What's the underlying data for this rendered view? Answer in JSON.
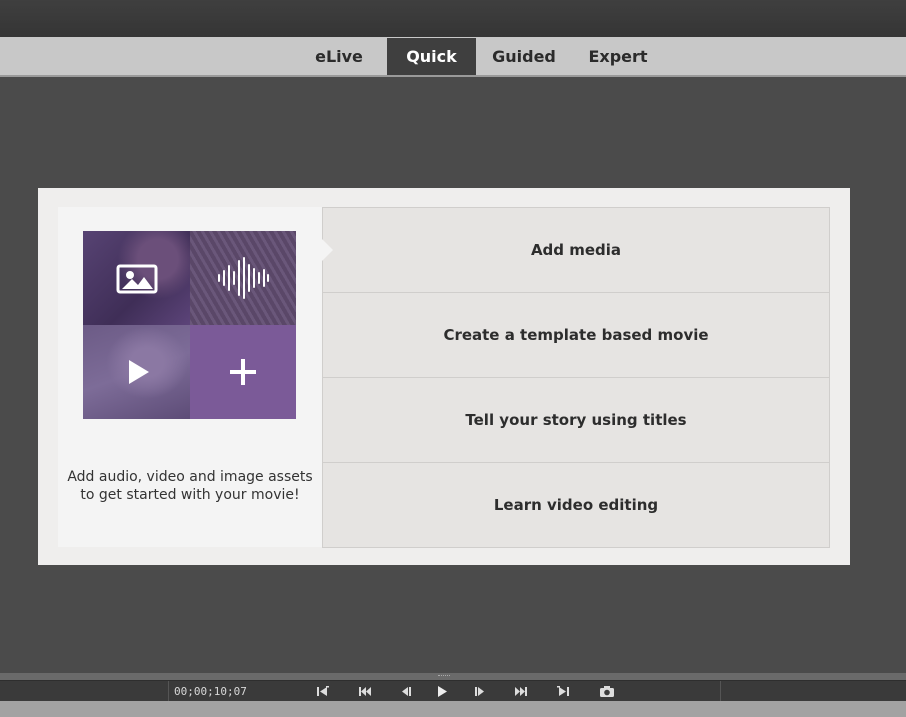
{
  "mode_tabs": [
    {
      "label": "eLive",
      "active": false
    },
    {
      "label": "Quick",
      "active": true
    },
    {
      "label": "Guided",
      "active": false
    },
    {
      "label": "Expert",
      "active": false
    }
  ],
  "welcome": {
    "caption_line1": "Add audio, video and image assets",
    "caption_line2": "to get started with your movie!",
    "tiles": [
      "image-icon",
      "audio-waveform-icon",
      "play-icon",
      "plus-icon"
    ],
    "options": [
      "Add media",
      "Create a template based movie",
      "Tell your story using titles",
      "Learn video editing"
    ]
  },
  "transport": {
    "timecode": "00;00;10;07",
    "buttons": [
      "go-to-start-icon",
      "previous-edit-icon",
      "step-back-icon",
      "play-icon",
      "step-forward-icon",
      "next-edit-icon",
      "go-to-end-icon",
      "snapshot-icon"
    ]
  },
  "colors": {
    "accent_purple": "#7b5a98",
    "active_tab": "#3f3f3f",
    "workspace": "#4b4b4b"
  }
}
